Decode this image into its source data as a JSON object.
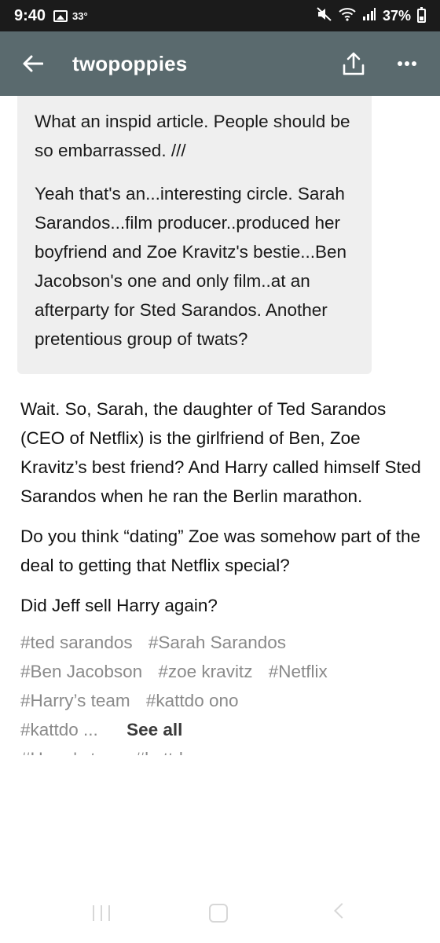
{
  "status_bar": {
    "time": "9:40",
    "temperature": "33°",
    "battery": "37%"
  },
  "header": {
    "blog_name": "twopoppies",
    "background": "#5a6a6e"
  },
  "quote": {
    "paragraphs": [
      "What an inspid article. People should be so embarrassed. ///",
      "Yeah that's an...interesting circle. Sarah Sarandos...film producer..produced her boyfriend and Zoe Kravitz's bestie...Ben Jacobson's one and only film..at an afterparty for Sted Sarandos. Another pretentious group of twats?"
    ]
  },
  "post": {
    "paragraphs": [
      "Wait. So, Sarah, the daughter of Ted Sarandos (CEO of Netflix) is the girlfriend of Ben, Zoe Kravitz’s best friend? And Harry called himself Sted Sarandos when he ran the Berlin marathon.",
      "Do you think “dating” Zoe was somehow part of the deal to getting that Netflix special?",
      "Did Jeff sell Harry again?"
    ]
  },
  "tags": {
    "items": [
      "#ted sarandos",
      "#Sarah Sarandos",
      "#Ben Jacobson",
      "#zoe kravitz",
      "#Netflix",
      "#Harry’s team",
      "#kattdo ono"
    ],
    "truncated": "#kattdo ...",
    "see_all": "See all",
    "next_line_partial": "#Harry's team   #kattdo"
  },
  "icons": {
    "back": "arrow-left-icon",
    "share": "share-upload-icon",
    "more": "more-dots-icon",
    "mute": "mute-icon",
    "wifi": "wifi-icon",
    "signal": "signal-icon",
    "image": "image-icon",
    "battery": "battery-icon"
  }
}
